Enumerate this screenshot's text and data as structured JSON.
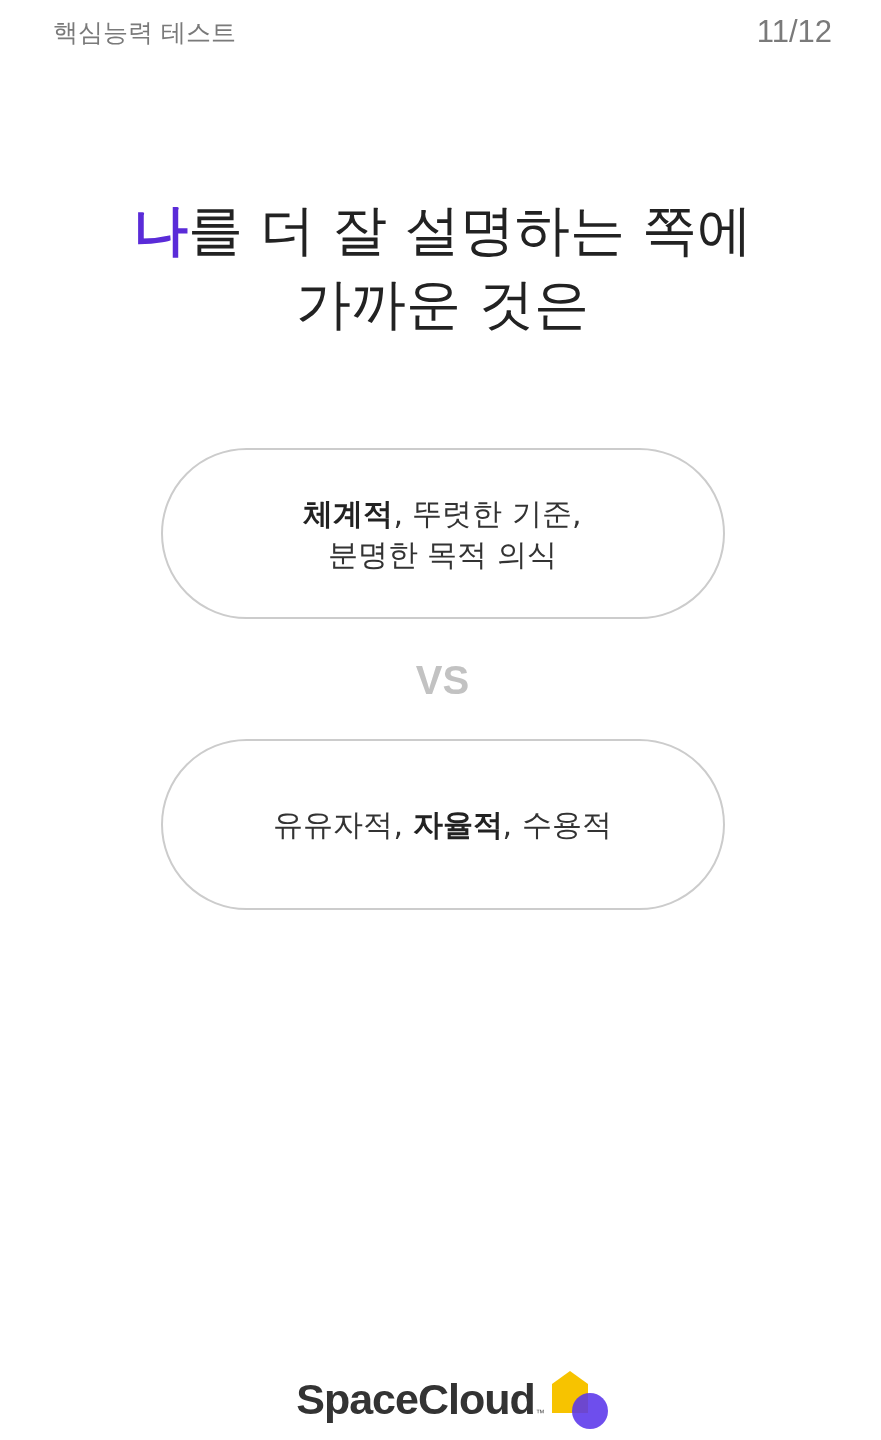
{
  "header": {
    "title": "핵심능력 테스트",
    "progress": "11/12"
  },
  "question": {
    "accent": "나",
    "lines": [
      "를 더 잘 설명하는 쪽에",
      "가까운 것은"
    ]
  },
  "options": [
    {
      "text": "**체계적**, 뚜렷한 기준,\n분명한 목적 의식",
      "selected": false
    },
    {
      "text": "유유자적, **자율적**, 수용적",
      "selected": false
    }
  ],
  "divider_label": "VS",
  "footer": {
    "brand": "SpaceCloud",
    "trademark": "™"
  }
}
